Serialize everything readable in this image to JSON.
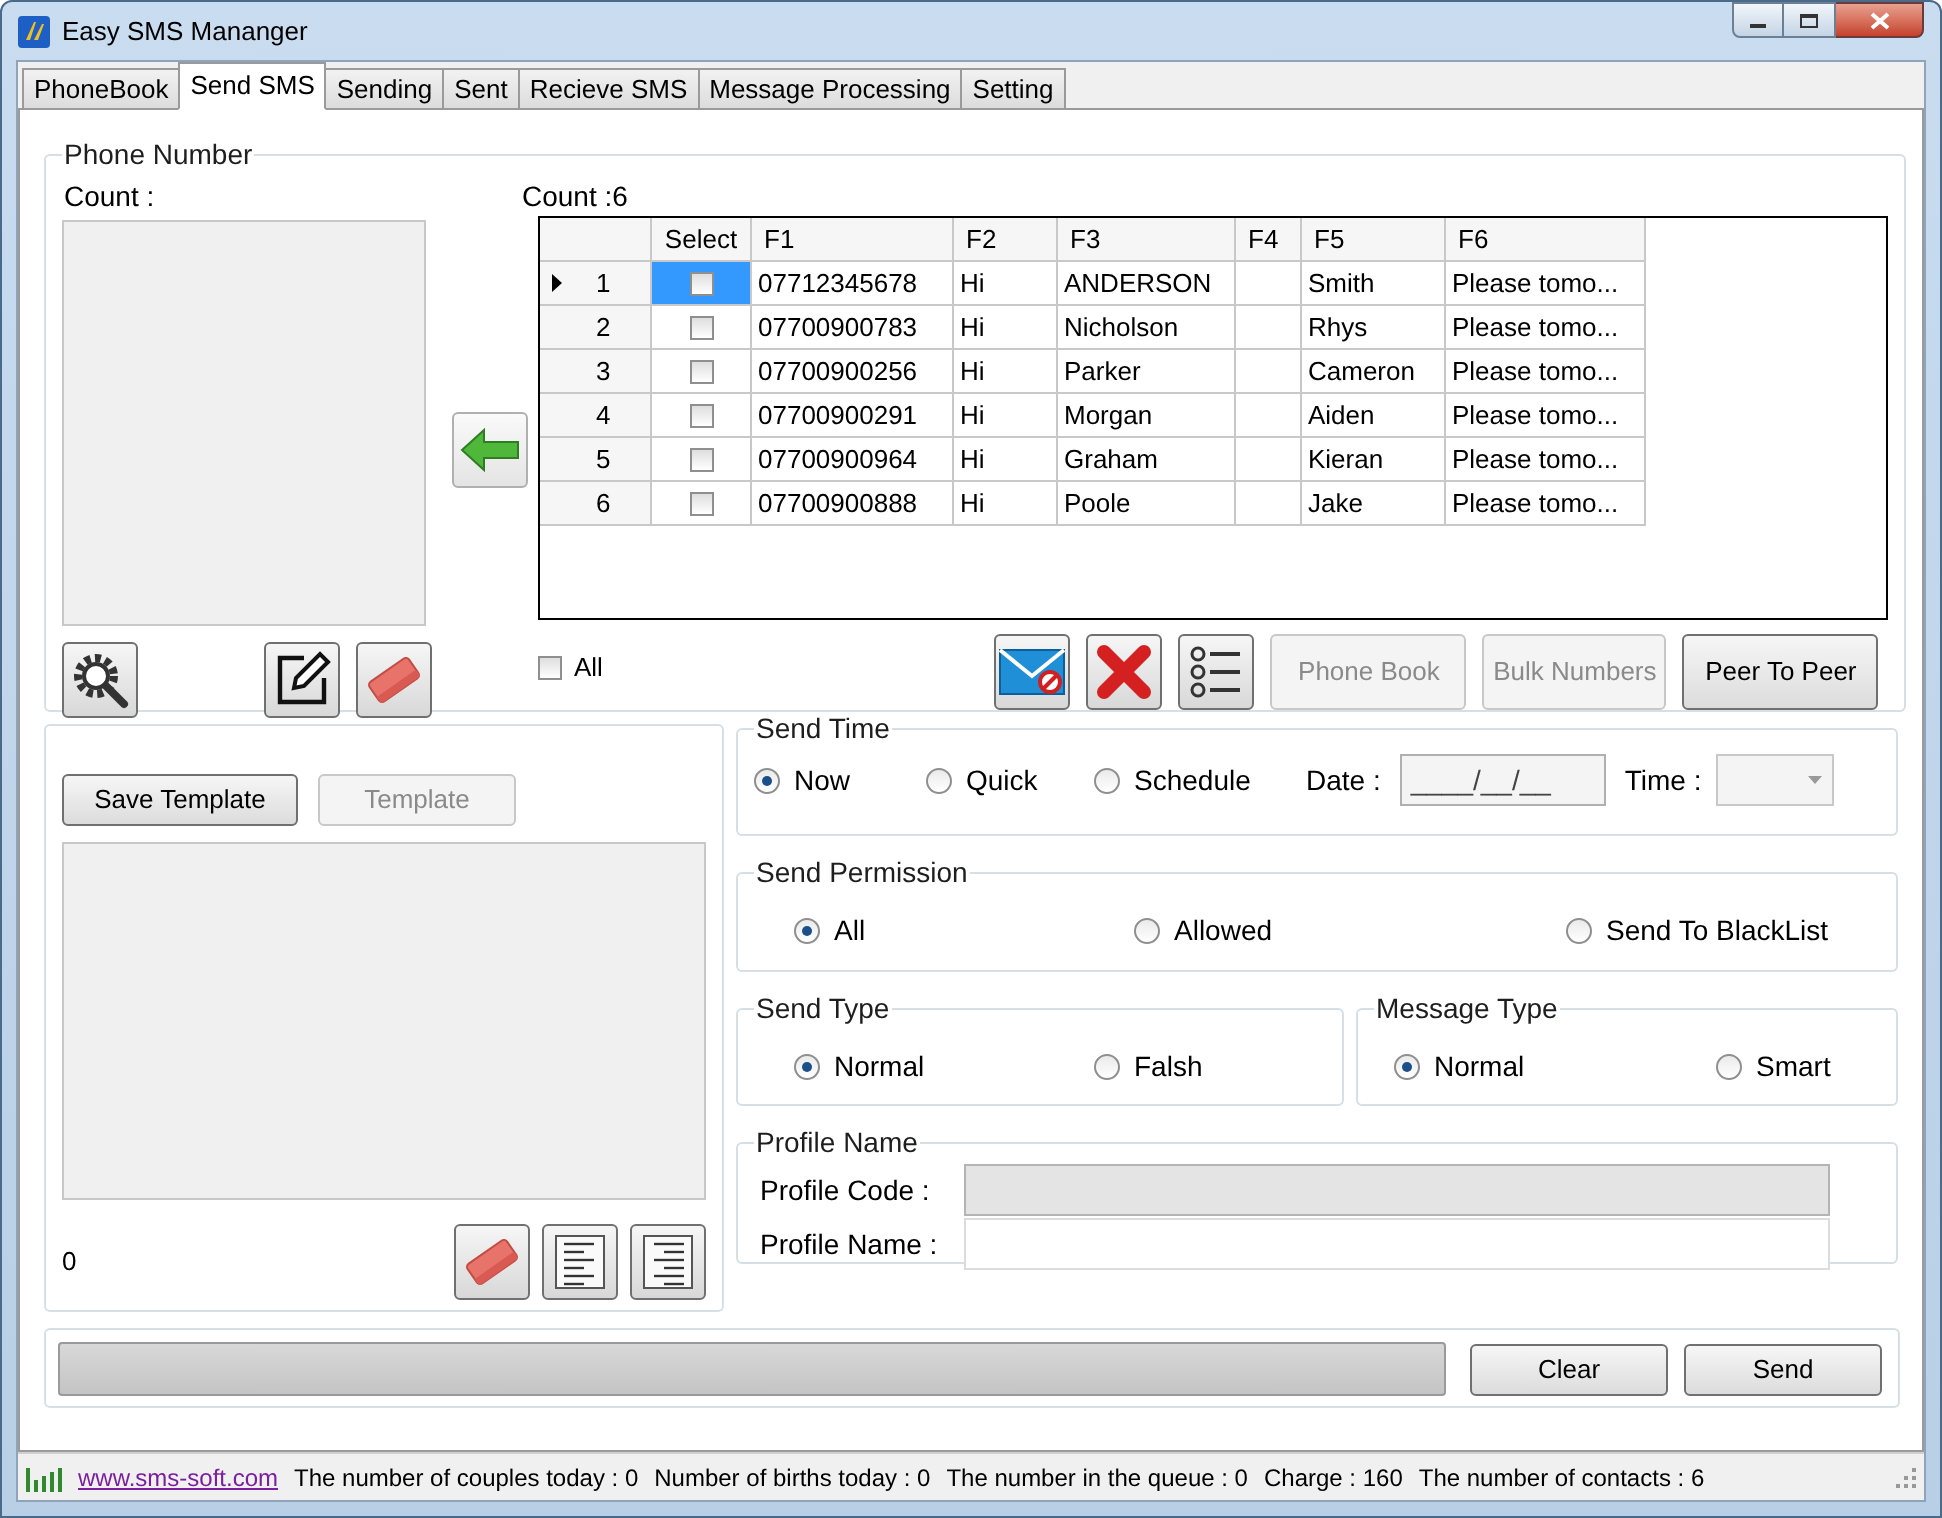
{
  "window": {
    "title": "Easy SMS Mananger"
  },
  "tabs": [
    {
      "label": "PhoneBook",
      "selected": false
    },
    {
      "label": "Send SMS",
      "selected": true
    },
    {
      "label": "Sending",
      "selected": false
    },
    {
      "label": "Sent",
      "selected": false
    },
    {
      "label": "Recieve SMS",
      "selected": false
    },
    {
      "label": "Message Processing",
      "selected": false
    },
    {
      "label": "Setting",
      "selected": false
    }
  ],
  "phone_number": {
    "legend": "Phone Number",
    "count_label": "Count :",
    "grid_count": "Count :6",
    "grid": {
      "columns": [
        "Select",
        "F1",
        "F2",
        "F3",
        "F4",
        "F5",
        "F6"
      ],
      "rows": [
        {
          "number": "1",
          "current": true,
          "checked": false,
          "cells": [
            "",
            "07712345678",
            "Hi",
            "ANDERSON",
            "",
            "Smith",
            "Please tomo..."
          ]
        },
        {
          "number": "2",
          "current": false,
          "checked": false,
          "cells": [
            "",
            "07700900783",
            "Hi",
            "Nicholson",
            "",
            "Rhys",
            "Please tomo..."
          ]
        },
        {
          "number": "3",
          "current": false,
          "checked": false,
          "cells": [
            "",
            "07700900256",
            "Hi",
            "Parker",
            "",
            "Cameron",
            "Please tomo..."
          ]
        },
        {
          "number": "4",
          "current": false,
          "checked": false,
          "cells": [
            "",
            "07700900291",
            "Hi",
            "Morgan",
            "",
            "Aiden",
            "Please tomo..."
          ]
        },
        {
          "number": "5",
          "current": false,
          "checked": false,
          "cells": [
            "",
            "07700900964",
            "Hi",
            "Graham",
            "",
            "Kieran",
            "Please tomo..."
          ]
        },
        {
          "number": "6",
          "current": false,
          "checked": false,
          "cells": [
            "",
            "07700900888",
            "Hi",
            "Poole",
            "",
            "Jake",
            "Please tomo..."
          ]
        }
      ]
    },
    "all_checkbox": {
      "label": "All",
      "checked": false
    },
    "buttons": [
      {
        "label": "Phone Book",
        "disabled": true
      },
      {
        "label": "Bulk Numbers",
        "disabled": true
      },
      {
        "label": "Peer To Peer",
        "disabled": false
      }
    ]
  },
  "template": {
    "save_button": {
      "label": "Save Template",
      "disabled": false
    },
    "template_button": {
      "label": "Template",
      "disabled": true
    },
    "char_count": "0"
  },
  "send_time": {
    "legend": "Send Time",
    "options": [
      {
        "label": "Now",
        "selected": true
      },
      {
        "label": "Quick",
        "selected": false
      },
      {
        "label": "Schedule",
        "selected": false
      }
    ],
    "date_label": "Date :",
    "date_value": "____/__/__",
    "time_label": "Time :"
  },
  "send_permission": {
    "legend": "Send Permission",
    "options": [
      {
        "label": "All",
        "selected": true
      },
      {
        "label": "Allowed",
        "selected": false
      },
      {
        "label": "Send To BlackList",
        "selected": false
      }
    ]
  },
  "send_type": {
    "legend": "Send Type",
    "options": [
      {
        "label": "Normal",
        "selected": true
      },
      {
        "label": "Falsh",
        "selected": false
      }
    ]
  },
  "message_type": {
    "legend": "Message Type",
    "options": [
      {
        "label": "Normal",
        "selected": true
      },
      {
        "label": "Smart",
        "selected": false
      }
    ]
  },
  "profile": {
    "legend": "Profile Name",
    "fields": [
      {
        "label": "Profile Code :",
        "disabled": true
      },
      {
        "label": "Profile Name :",
        "disabled": false
      }
    ]
  },
  "progress": {
    "level": 0
  },
  "actions": [
    {
      "label": "Clear"
    },
    {
      "label": "Send"
    }
  ],
  "status_bar": {
    "link": "www.sms-soft.com",
    "items": [
      "The number of couples today : 0",
      "Number of births today : 0",
      "The number in the queue : 0",
      "Charge : 160",
      "The number of contacts : 6"
    ]
  }
}
